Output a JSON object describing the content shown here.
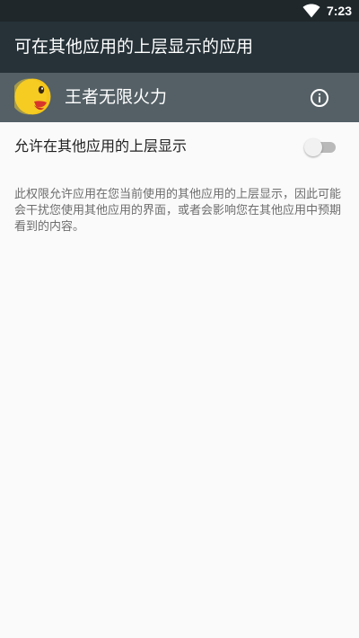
{
  "status_bar": {
    "time": "7:23",
    "wifi_icon": "wifi-icon"
  },
  "app_bar": {
    "title": "可在其他应用的上层显示的应用"
  },
  "app_header": {
    "name": "王者无限火力",
    "avatar_icon": "emoji-face-icon",
    "info_icon": "info-icon"
  },
  "setting": {
    "label": "允许在其他应用的上层显示",
    "enabled": false
  },
  "description": "此权限允许应用在您当前使用的其他应用的上层显示，因此可能会干扰您使用其他应用的界面，或者会影响您在其他应用中预期看到的内容。",
  "colors": {
    "status_bar": "#1f272b",
    "app_bar": "#263238",
    "app_header": "#546066",
    "background": "#fafafa"
  }
}
